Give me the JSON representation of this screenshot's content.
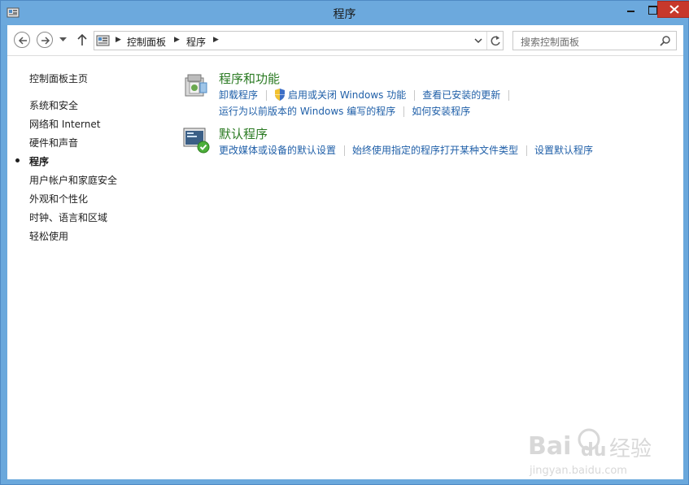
{
  "window": {
    "title": "程序",
    "minimize_icon": "minimize-icon",
    "maximize_icon": "maximize-icon",
    "close_icon": "close-icon"
  },
  "address_bar": {
    "breadcrumbs": [
      "控制面板",
      "程序"
    ],
    "location_icon": "control-panel-icon"
  },
  "search": {
    "placeholder": "搜索控制面板"
  },
  "sidebar": {
    "home": "控制面板主页",
    "items": [
      {
        "label": "系统和安全",
        "current": false
      },
      {
        "label": "网络和 Internet",
        "current": false
      },
      {
        "label": "硬件和声音",
        "current": false
      },
      {
        "label": "程序",
        "current": true
      },
      {
        "label": "用户帐户和家庭安全",
        "current": false
      },
      {
        "label": "外观和个性化",
        "current": false
      },
      {
        "label": "时钟、语言和区域",
        "current": false
      },
      {
        "label": "轻松使用",
        "current": false
      }
    ]
  },
  "categories": [
    {
      "title": "程序和功能",
      "icon": "programs-and-features-icon",
      "links_row1": [
        "卸载程序",
        "启用或关闭 Windows 功能",
        "查看已安装的更新"
      ],
      "links_row2": [
        "运行为以前版本的 Windows 编写的程序",
        "如何安装程序"
      ]
    },
    {
      "title": "默认程序",
      "icon": "default-programs-icon",
      "links_row1": [
        "更改媒体或设备的默认设置",
        "始终使用指定的程序打开某种文件类型",
        "设置默认程序"
      ]
    }
  ],
  "watermark": {
    "text": "Baidu 经验",
    "subtext": "jingyan.baidu.com"
  },
  "colors": {
    "titlebar": "#6ca9dd",
    "close_button": "#c7382b",
    "link": "#1f5fa8",
    "category_title": "#2a7a22"
  }
}
